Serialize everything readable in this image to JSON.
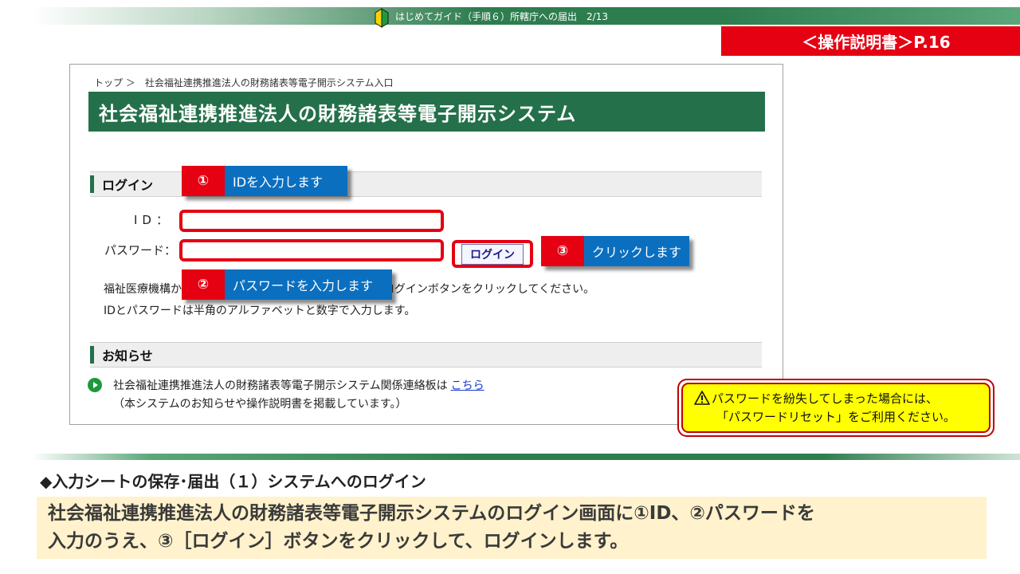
{
  "banner": {
    "text": "はじめてガイド（手順６）所轄庁への届出　2/13"
  },
  "manual_ref": "＜操作説明書＞P.16",
  "screenshot": {
    "breadcrumb": "トップ ＞　社会福祉連携推進法人の財務諸表等電子開示システム入口",
    "system_title": "社会福祉連携推進法人の財務諸表等電子開示システム",
    "login_section": "ログイン",
    "id_label": "ID：",
    "password_label": "パスワード：",
    "id_value": "",
    "password_value": "",
    "login_button": "ログイン",
    "help_line1": "福祉医療機構から通知されたIDとパスワードを入力し、ログインボタンをクリックしてください。",
    "help_line2": "IDとパスワードは半角のアルファベットと数字で入力します。",
    "notice_section": "お知らせ",
    "notice_line1": "社会福祉連携推進法人の財務諸表等電子開示システム関係連絡板は",
    "notice_link": "こちら",
    "notice_line2": "（本システムのお知らせや操作説明書を掲載しています。）"
  },
  "callouts": [
    {
      "num": "①",
      "text": "IDを入力します"
    },
    {
      "num": "②",
      "text": "パスワードを入力します"
    },
    {
      "num": "③",
      "text": "クリックします"
    }
  ],
  "warning": {
    "line1": "パスワードを紛失してしまった場合には、",
    "line2": "「パスワードリセット」をご利用ください。"
  },
  "section_title": "◆入力シートの保存･届出（１）システムへのログイン",
  "description": {
    "line1": "社会福祉連携推進法人の財務諸表等電子開示システムのログイン画面に①ID、②パスワードを",
    "line2": "入力のうえ、③［ログイン］ボタンをクリックして、ログインします。"
  },
  "colors": {
    "green": "#24704a",
    "red": "#e50012",
    "blue": "#0b6fc0",
    "warning_yellow": "#ffff00",
    "description_bg": "#fff2cc"
  }
}
